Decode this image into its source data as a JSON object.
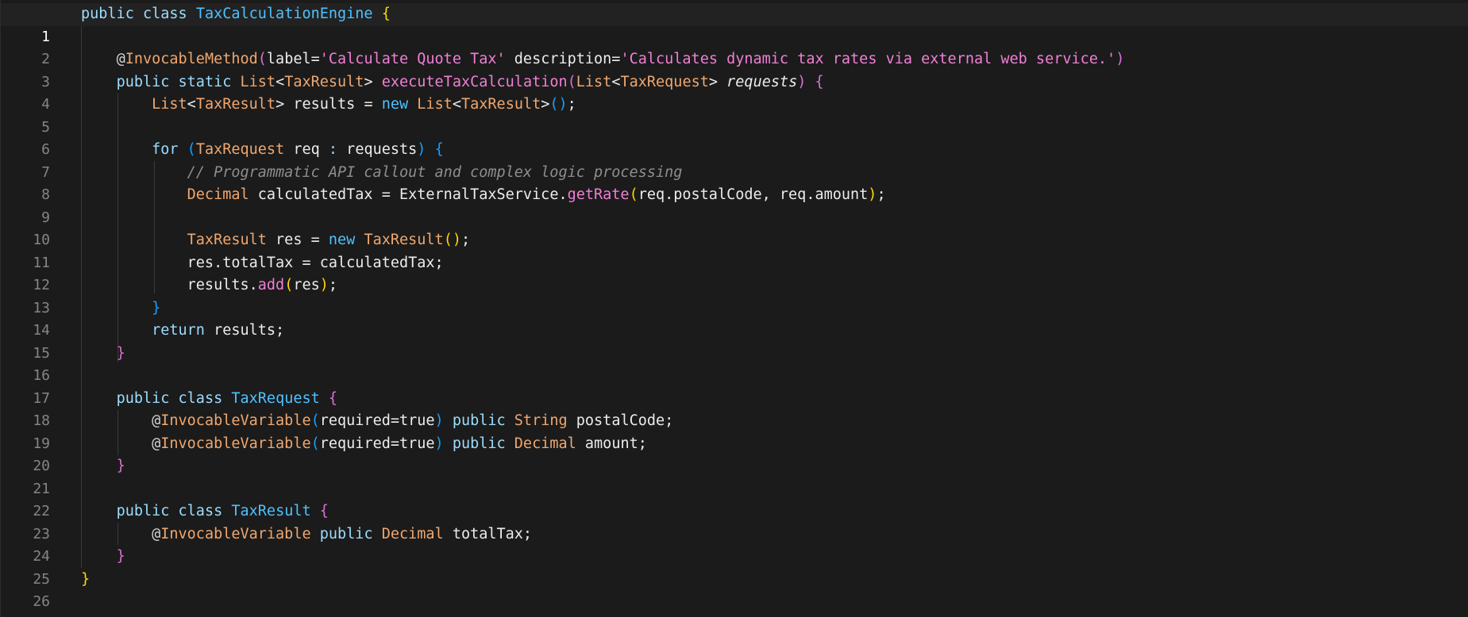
{
  "editor": {
    "current_line": 1,
    "lines": [
      {
        "n": "1"
      },
      {
        "n": "2"
      },
      {
        "n": "3"
      },
      {
        "n": "4"
      },
      {
        "n": "5"
      },
      {
        "n": "6"
      },
      {
        "n": "7"
      },
      {
        "n": "8"
      },
      {
        "n": "9"
      },
      {
        "n": "10"
      },
      {
        "n": "11"
      },
      {
        "n": "12"
      },
      {
        "n": "13"
      },
      {
        "n": "14"
      },
      {
        "n": "15"
      },
      {
        "n": "16"
      },
      {
        "n": "17"
      },
      {
        "n": "18"
      },
      {
        "n": "19"
      },
      {
        "n": "20"
      },
      {
        "n": "21"
      },
      {
        "n": "22"
      },
      {
        "n": "23"
      },
      {
        "n": "24"
      },
      {
        "n": "25"
      },
      {
        "n": "26"
      }
    ]
  },
  "tokens": {
    "l1": {
      "kw_public": "public",
      "kw_class": "class",
      "cls_name": "TaxCalculationEngine",
      "brace": "{"
    },
    "l3": {
      "at": "@",
      "ann": "InvocableMethod",
      "open": "(",
      "label_key": "label=",
      "label_val": "'Calculate Quote Tax'",
      "desc_key": " description=",
      "desc_val": "'Calculates dynamic tax rates via external web service.'",
      "close": ")"
    },
    "l4": {
      "kw_public": "public",
      "kw_static": "static",
      "type_list": "List",
      "lt": "<",
      "type_res": "TaxResult",
      "gt": ">",
      "fn": "executeTaxCalculation",
      "open": "(",
      "type_list2": "List",
      "lt2": "<",
      "type_req": "TaxRequest",
      "gt2": ">",
      "param": "requests",
      "close": ")",
      "brace": "{"
    },
    "l5": {
      "type_list": "List",
      "lt": "<",
      "type_res": "TaxResult",
      "gt": ">",
      "var": " results = ",
      "kw_new": "new",
      "type_list2": "List",
      "lt2": "<",
      "type_res2": "TaxResult",
      "gt2": ">",
      "parens": "()",
      "semi": ";"
    },
    "l7": {
      "kw_for": "for",
      "open": "(",
      "type_req": "TaxRequest",
      "rest": " req ",
      "colon": ":",
      "rest2": " requests",
      "close": ")",
      "brace": "{"
    },
    "l8": {
      "comment": "// Programmatic API callout and complex logic processing"
    },
    "l9": {
      "type_dec": "Decimal",
      "rest": " calculatedTax = ExternalTaxService.",
      "fn": "getRate",
      "open": "(",
      "args": "req.postalCode, req.amount",
      "close": ")",
      "semi": ";"
    },
    "l11": {
      "type_res": "TaxResult",
      "rest": " res = ",
      "kw_new": "new",
      "type_res2": "TaxResult",
      "parens": "()",
      "semi": ";"
    },
    "l12": {
      "text": "res.totalTax = calculatedTax;"
    },
    "l13": {
      "pre": "results.",
      "fn": "add",
      "open": "(",
      "arg": "res",
      "close": ")",
      "semi": ";"
    },
    "l14": {
      "brace": "}"
    },
    "l15": {
      "kw_return": "return",
      "rest": " results;"
    },
    "l16": {
      "brace": "}"
    },
    "l18": {
      "kw_public": "public",
      "kw_class": "class",
      "cls_name": "TaxRequest",
      "brace": "{"
    },
    "l19": {
      "at": "@",
      "ann": "InvocableVariable",
      "open": "(",
      "arg": "required=true",
      "close": ")",
      "kw_public": "public",
      "type": "String",
      "rest": " postalCode;"
    },
    "l20": {
      "at": "@",
      "ann": "InvocableVariable",
      "open": "(",
      "arg": "required=true",
      "close": ")",
      "kw_public": "public",
      "type": "Decimal",
      "rest": " amount;"
    },
    "l21": {
      "brace": "}"
    },
    "l23": {
      "kw_public": "public",
      "kw_class": "class",
      "cls_name": "TaxResult",
      "brace": "{"
    },
    "l24": {
      "at": "@",
      "ann": "InvocableVariable",
      "kw_public": "public",
      "type": "Decimal",
      "rest": " totalTax;"
    },
    "l25": {
      "brace": "}"
    },
    "l26": {
      "brace": "}"
    }
  },
  "colors": {
    "background": "#1b1b1b",
    "keyword": "#9cdcfe",
    "class_name": "#4fc1ff",
    "type": "#f0a76e",
    "function": "#f07fd5",
    "string": "#f07fd5",
    "comment": "#8e8e8e",
    "bracket_gold": "#ffd700",
    "bracket_orchid": "#da70d6",
    "bracket_blue": "#179fff"
  }
}
